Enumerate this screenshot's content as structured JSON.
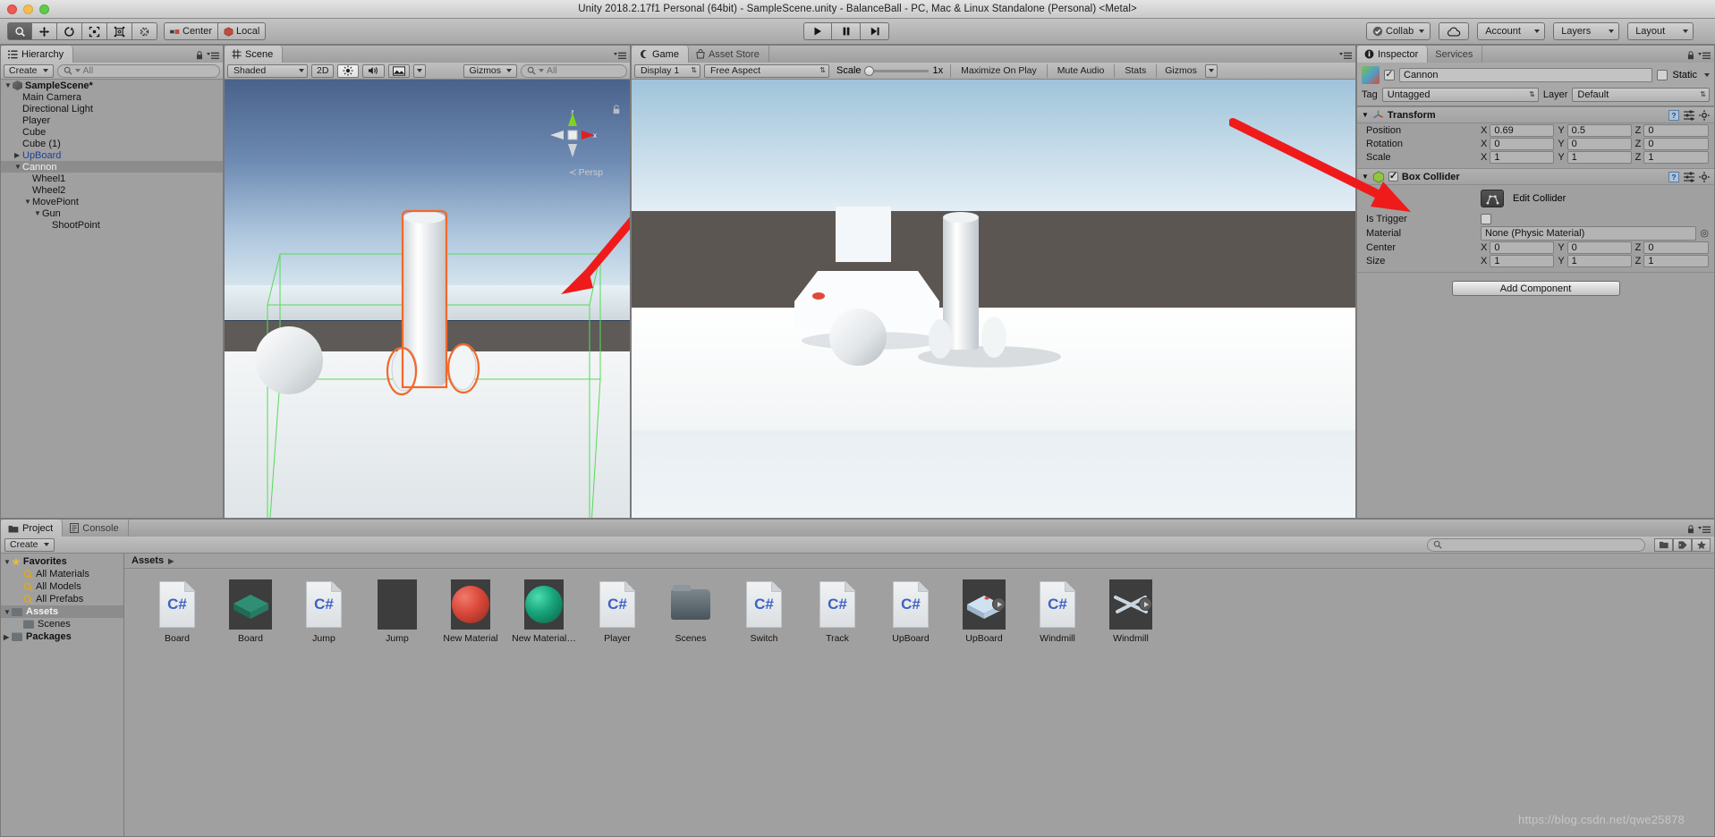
{
  "window": {
    "title": "Unity 2018.2.17f1 Personal (64bit) - SampleScene.unity - BalanceBall - PC, Mac & Linux Standalone (Personal) <Metal>"
  },
  "toolbar": {
    "tools": [
      "hand-tool",
      "move-tool",
      "rotate-tool",
      "scale-tool",
      "rect-tool",
      "transform-tool"
    ],
    "pivot_mode": "Center",
    "pivot_rotation": "Local",
    "play": "▶",
    "pause": "❚❚",
    "step": "▶❙",
    "collab": "Collab",
    "cloud": "cloud-icon",
    "account": "Account",
    "layers": "Layers",
    "layout": "Layout"
  },
  "hierarchy": {
    "tab": "Hierarchy",
    "create_label": "Create",
    "search_placeholder": "All",
    "items": [
      {
        "label": "SampleScene*",
        "depth": 0,
        "arrow": "down",
        "icon": "unity-scene-icon",
        "bold": true,
        "selected": false,
        "blue": false
      },
      {
        "label": "Main Camera",
        "depth": 1,
        "arrow": "",
        "icon": "",
        "bold": false,
        "selected": false,
        "blue": false
      },
      {
        "label": "Directional Light",
        "depth": 1,
        "arrow": "",
        "icon": "",
        "bold": false,
        "selected": false,
        "blue": false
      },
      {
        "label": "Player",
        "depth": 1,
        "arrow": "",
        "icon": "",
        "bold": false,
        "selected": false,
        "blue": false
      },
      {
        "label": "Cube",
        "depth": 1,
        "arrow": "",
        "icon": "",
        "bold": false,
        "selected": false,
        "blue": false
      },
      {
        "label": "Cube (1)",
        "depth": 1,
        "arrow": "",
        "icon": "",
        "bold": false,
        "selected": false,
        "blue": false
      },
      {
        "label": "UpBoard",
        "depth": 1,
        "arrow": "right",
        "icon": "",
        "bold": false,
        "selected": false,
        "blue": true
      },
      {
        "label": "Cannon",
        "depth": 1,
        "arrow": "down",
        "icon": "",
        "bold": false,
        "selected": true,
        "blue": false
      },
      {
        "label": "Wheel1",
        "depth": 2,
        "arrow": "",
        "icon": "",
        "bold": false,
        "selected": false,
        "blue": false
      },
      {
        "label": "Wheel2",
        "depth": 2,
        "arrow": "",
        "icon": "",
        "bold": false,
        "selected": false,
        "blue": false
      },
      {
        "label": "MovePiont",
        "depth": 2,
        "arrow": "down",
        "icon": "",
        "bold": false,
        "selected": false,
        "blue": false
      },
      {
        "label": "Gun",
        "depth": 3,
        "arrow": "down",
        "icon": "",
        "bold": false,
        "selected": false,
        "blue": false
      },
      {
        "label": "ShootPoint",
        "depth": 4,
        "arrow": "",
        "icon": "",
        "bold": false,
        "selected": false,
        "blue": false
      }
    ]
  },
  "scene": {
    "tab": "Scene",
    "draw_mode": "Shaded",
    "mode_2d": "2D",
    "lighting": "lighting-icon",
    "audio": "audio-icon",
    "fx": "fx-icon",
    "gizmos": "Gizmos",
    "search_placeholder": "All",
    "axis_x": "x",
    "axis_y": "y",
    "perspective_label": "Persp"
  },
  "game": {
    "tab": "Game",
    "asset_store_tab": "Asset Store",
    "display": "Display 1",
    "aspect": "Free Aspect",
    "scale_label": "Scale",
    "scale_value": "1x",
    "maximize_on_play": "Maximize On Play",
    "mute_audio": "Mute Audio",
    "stats": "Stats",
    "gizmos": "Gizmos"
  },
  "inspector": {
    "tab": "Inspector",
    "services_tab": "Services",
    "object_name": "Cannon",
    "enabled": true,
    "static_label": "Static",
    "tag_label": "Tag",
    "tag_value": "Untagged",
    "layer_label": "Layer",
    "layer_value": "Default",
    "transform": {
      "title": "Transform",
      "rows": [
        {
          "label": "Position",
          "x": "0.69",
          "y": "0.5",
          "z": "0"
        },
        {
          "label": "Rotation",
          "x": "0",
          "y": "0",
          "z": "0"
        },
        {
          "label": "Scale",
          "x": "1",
          "y": "1",
          "z": "1"
        }
      ]
    },
    "box_collider": {
      "title": "Box Collider",
      "enabled": true,
      "edit_collider_label": "Edit Collider",
      "is_trigger_label": "Is Trigger",
      "is_trigger_value": false,
      "material_label": "Material",
      "material_value": "None (Physic Material)",
      "rows": [
        {
          "label": "Center",
          "x": "0",
          "y": "0",
          "z": "0"
        },
        {
          "label": "Size",
          "x": "1",
          "y": "1",
          "z": "1"
        }
      ]
    },
    "add_component": "Add Component"
  },
  "project": {
    "tab": "Project",
    "console_tab": "Console",
    "create_label": "Create",
    "search_placeholder": "",
    "breadcrumb": "Assets",
    "tree": [
      {
        "label": "Favorites",
        "depth": 0,
        "arrow": "down",
        "icon": "star-icon",
        "selected": false,
        "bold": true
      },
      {
        "label": "All Materials",
        "depth": 1,
        "arrow": "",
        "icon": "search-icon",
        "selected": false,
        "bold": false
      },
      {
        "label": "All Models",
        "depth": 1,
        "arrow": "",
        "icon": "search-icon",
        "selected": false,
        "bold": false
      },
      {
        "label": "All Prefabs",
        "depth": 1,
        "arrow": "",
        "icon": "search-icon",
        "selected": false,
        "bold": false
      },
      {
        "label": "Assets",
        "depth": 0,
        "arrow": "down",
        "icon": "folder-icon",
        "selected": true,
        "bold": true
      },
      {
        "label": "Scenes",
        "depth": 1,
        "arrow": "",
        "icon": "folder-icon",
        "selected": false,
        "bold": false
      },
      {
        "label": "Packages",
        "depth": 0,
        "arrow": "right",
        "icon": "folder-icon",
        "selected": false,
        "bold": true
      }
    ],
    "assets": [
      {
        "label": "Board",
        "type": "cs",
        "badge": false
      },
      {
        "label": "Board",
        "type": "model-board",
        "badge": false
      },
      {
        "label": "Jump",
        "type": "cs",
        "badge": false
      },
      {
        "label": "Jump",
        "type": "blank",
        "badge": false
      },
      {
        "label": "New Material",
        "type": "material-red",
        "badge": false
      },
      {
        "label": "New Material…",
        "type": "material-green",
        "badge": false
      },
      {
        "label": "Player",
        "type": "cs",
        "badge": false
      },
      {
        "label": "Scenes",
        "type": "folder",
        "badge": false
      },
      {
        "label": "Switch",
        "type": "cs",
        "badge": false
      },
      {
        "label": "Track",
        "type": "cs",
        "badge": false
      },
      {
        "label": "UpBoard",
        "type": "cs",
        "badge": false
      },
      {
        "label": "UpBoard",
        "type": "model-upboard",
        "badge": true
      },
      {
        "label": "Windmill",
        "type": "cs",
        "badge": false
      },
      {
        "label": "Windmill",
        "type": "model-windmill",
        "badge": true
      }
    ]
  },
  "watermark": "https://blog.csdn.net/qwe25878"
}
